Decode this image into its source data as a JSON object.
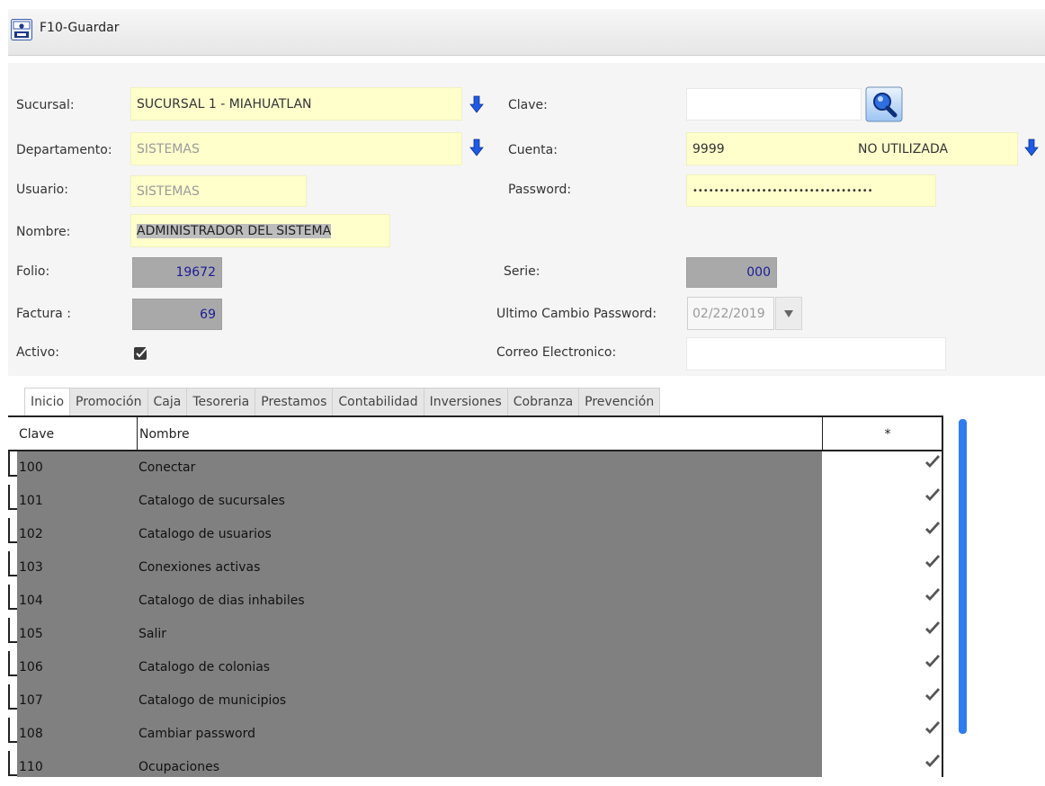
{
  "toolbar": {
    "save_label": "F10-Guardar"
  },
  "form": {
    "sucursal_label": "Sucursal:",
    "sucursal_value": "SUCURSAL 1 - MIAHUATLAN",
    "departamento_label": "Departamento:",
    "departamento_value": "SISTEMAS",
    "usuario_label": "Usuario:",
    "usuario_value": "SISTEMAS",
    "nombre_label": "Nombre:",
    "nombre_value": "ADMINISTRADOR DEL SISTEMA",
    "folio_label": "Folio:",
    "folio_value": "19672",
    "factura_label": "Factura :",
    "factura_value": "69",
    "activo_label": "Activo:",
    "clave_label": "Clave:",
    "clave_value": "",
    "cuenta_label": "Cuenta:",
    "cuenta_value": "9999",
    "cuenta_desc": "NO UTILIZADA",
    "password_label": "Password:",
    "password_value": "••••••••••••••••••••••••••••••••••",
    "serie_label": "Serie:",
    "serie_value": "000",
    "ultimo_label": "Ultimo Cambio Password:",
    "ultimo_value": "02/22/2019",
    "correo_label": "Correo Electronico:",
    "correo_value": ""
  },
  "tabs": [
    "Inicio",
    "Promoción",
    "Caja",
    "Tesoreria",
    "Prestamos",
    "Contabilidad",
    "Inversiones",
    "Cobranza",
    "Prevención"
  ],
  "grid": {
    "headers": {
      "clave": "Clave",
      "nombre": "Nombre",
      "mark": "*"
    },
    "rows": [
      {
        "clave": "100",
        "nombre": "Conectar"
      },
      {
        "clave": "101",
        "nombre": "Catalogo de sucursales"
      },
      {
        "clave": "102",
        "nombre": "Catalogo de usuarios"
      },
      {
        "clave": "103",
        "nombre": "Conexiones activas"
      },
      {
        "clave": "104",
        "nombre": "Catalogo de dias inhabiles"
      },
      {
        "clave": "105",
        "nombre": "Salir"
      },
      {
        "clave": "106",
        "nombre": "Catalogo de colonias"
      },
      {
        "clave": "107",
        "nombre": "Catalogo de municipios"
      },
      {
        "clave": "108",
        "nombre": "Cambiar password"
      },
      {
        "clave": "110",
        "nombre": "Ocupaciones"
      }
    ]
  },
  "colors": {
    "field_bg": "#ffffcc",
    "row_bg": "#808080",
    "accent": "#2e7df0"
  },
  "icons": {
    "save": "save-icon",
    "dropdown": "arrow-down-icon",
    "search": "search-icon",
    "check": "check-icon"
  }
}
